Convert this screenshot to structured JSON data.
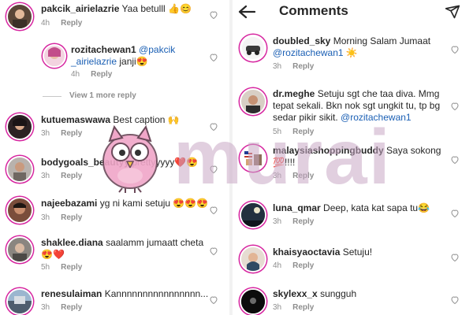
{
  "header": {
    "title": "Comments"
  },
  "left_comments": [
    {
      "user": "pakcik_airielazrie",
      "text": "Yaa betulll 👍😊",
      "time": "4h",
      "reply": "Reply"
    },
    {
      "user": "rozitachewan1",
      "mention1": "@pakcik",
      "mention2": "_airielazrie",
      "text": "janji😍",
      "time": "4h",
      "reply": "Reply"
    },
    {
      "user": "kutuemaswawa",
      "text": "Best caption 🙌",
      "time": "3h",
      "reply": "Reply"
    },
    {
      "user": "bodygoals_beautyy",
      "text": "prettyyyyy❤️😍",
      "time": "3h",
      "reply": "Reply"
    },
    {
      "user": "najeebazami",
      "text": "yg ni kami setuju 😍😍😍",
      "time": "3h",
      "reply": "Reply"
    },
    {
      "user": "shaklee.diana",
      "text": "saalamm jumaatt cheta",
      "text2": "😍❤️",
      "time": "5h",
      "reply": "Reply"
    },
    {
      "user": "renesulaiman",
      "text": "Kannnnnnnnnnnnnnnn...",
      "time": "3h",
      "reply": "Reply"
    }
  ],
  "view_more": "View 1 more reply",
  "right_comments": [
    {
      "user": "doubled_sky",
      "text": "Morning Salam Jumaat",
      "mention": "@rozitachewan1",
      "emoji": "☀️",
      "time": "3h",
      "reply": "Reply"
    },
    {
      "user": "dr.meghe",
      "text": "Setuju sgt che taa diva. Mmg",
      "line2": "tepat sekali. Bkn nok sgt ungkit tu, tp bg",
      "line3": "sedar pikir sikit.",
      "mention": "@rozitachewan1",
      "time": "5h",
      "reply": "Reply"
    },
    {
      "user": "malaysiashoppingbuddy",
      "text": "Saya sokong",
      "line2": "💯!!!!",
      "time": "3h",
      "reply": "Reply"
    },
    {
      "user": "luna_qmar",
      "text": "Deep, kata kat sapa tu😂",
      "time": "3h",
      "reply": "Reply"
    },
    {
      "user": "khaisyaoctavia",
      "text": "Setuju!",
      "time": "4h",
      "reply": "Reply"
    },
    {
      "user": "skylexx_x",
      "text": "sungguh",
      "time": "3h",
      "reply": "Reply"
    }
  ],
  "watermark": "murai",
  "colors": {
    "avatar_ring": "#d6249f",
    "mention": "#1a5fb4",
    "muted": "#8e8e8e"
  }
}
